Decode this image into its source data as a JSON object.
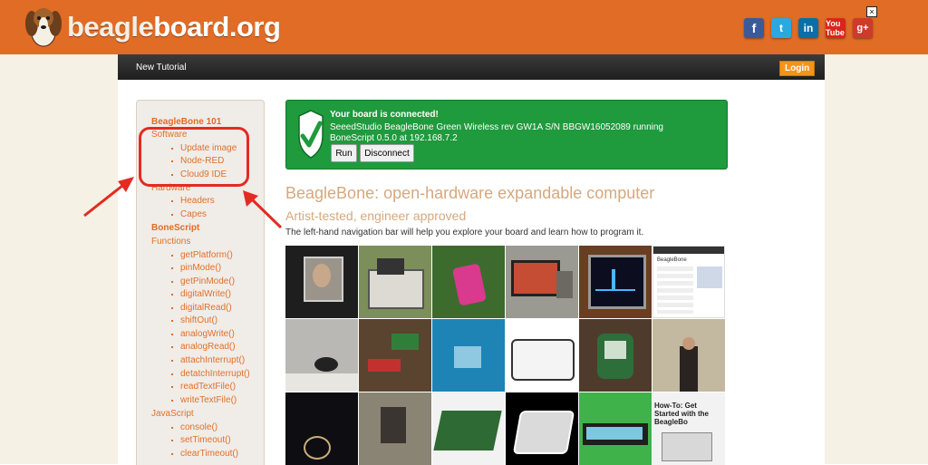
{
  "header": {
    "logo_word_a": "beagle",
    "logo_word_b": "board.org",
    "social": [
      {
        "label": "f",
        "icon": "facebook-icon"
      },
      {
        "label": "t",
        "icon": "twitter-icon"
      },
      {
        "label": "in",
        "icon": "linkedin-icon"
      },
      {
        "label": "You Tube",
        "icon": "youtube-icon"
      },
      {
        "label": "g+",
        "icon": "google-plus-icon"
      }
    ],
    "close_label": "×"
  },
  "navbar": {
    "title": "New Tutorial",
    "login_label": "Login"
  },
  "sidebar": {
    "beaglebone_101": "BeagleBone 101",
    "software": "Software",
    "software_items": [
      "Update image",
      "Node-RED",
      "Cloud9 IDE"
    ],
    "hardware": "Hardware",
    "hardware_items": [
      "Headers",
      "Capes"
    ],
    "bonescript": "BoneScript",
    "functions": "Functions",
    "function_items": [
      "getPlatform()",
      "pinMode()",
      "getPinMode()",
      "digitalWrite()",
      "digitalRead()",
      "shiftOut()",
      "analogWrite()",
      "analogRead()",
      "attachInterrupt()",
      "detatchInterrupt()",
      "readTextFile()",
      "writeTextFile()"
    ],
    "javascript": "JavaScript",
    "javascript_items": [
      "console()",
      "setTimeout()",
      "clearTimeout()"
    ]
  },
  "status": {
    "title": "Your board is connected!",
    "line1": "SeeedStudio BeagleBone Green Wireless rev GW1A S/N BBGW16052089 running",
    "line2": "BoneScript 0.5.0 at 192.168.7.2",
    "run_label": "Run",
    "disconnect_label": "Disconnect"
  },
  "content": {
    "title": "BeagleBone: open-hardware expandable computer",
    "subtitle": "Artist-tested, engineer approved",
    "description": "The left-hand navigation bar will help you explore your board and learn how to program it."
  },
  "gallery": {
    "tile_16_text": "How-To: Get Started with the BeagleBo",
    "tile_5_text": "BeagleBone"
  },
  "colors": {
    "header_orange": "#e06c25",
    "link_orange": "#e0712a",
    "connected_green": "#1f9a3d",
    "highlight_red": "#e32b22"
  }
}
